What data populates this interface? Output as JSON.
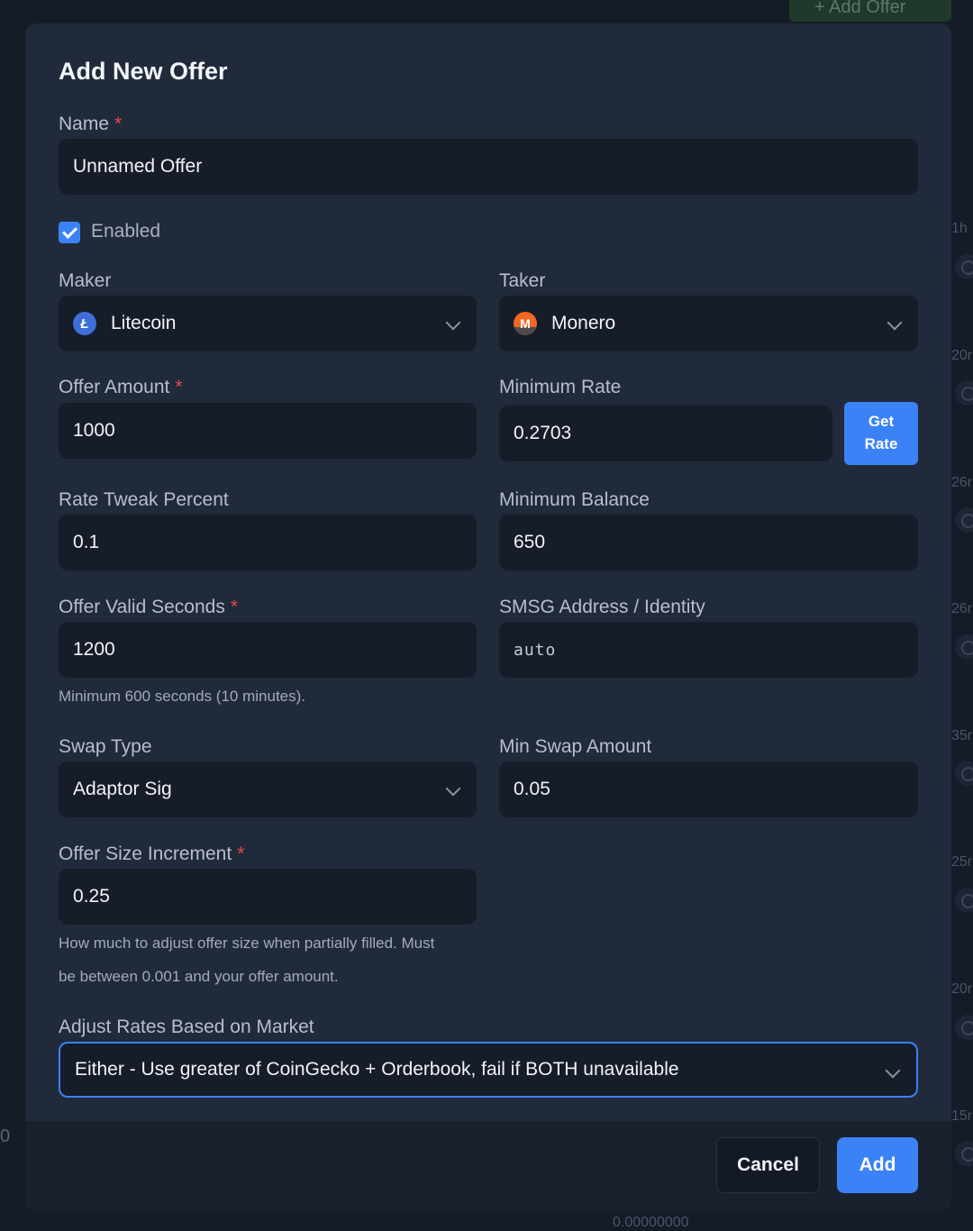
{
  "background": {
    "add_offer_button": "+ Add Offer",
    "left_value": "0",
    "bottom_value": "0.00000000",
    "right_column": [
      "1h",
      "20r",
      "26r",
      "26r",
      "35r",
      "25r",
      "20r",
      "15r"
    ]
  },
  "modal": {
    "title": "Add New Offer",
    "name": {
      "label": "Name",
      "required_mark": "*",
      "value": "Unnamed Offer"
    },
    "enabled": {
      "label": "Enabled",
      "checked": true
    },
    "maker": {
      "label": "Maker",
      "value": "Litecoin",
      "icon": "litecoin-icon"
    },
    "taker": {
      "label": "Taker",
      "value": "Monero",
      "icon": "monero-icon"
    },
    "offer_amount": {
      "label": "Offer Amount",
      "required_mark": "*",
      "value": "1000"
    },
    "minimum_rate": {
      "label": "Minimum Rate",
      "value": "0.2703",
      "get_rate_line1": "Get",
      "get_rate_line2": "Rate"
    },
    "rate_tweak_percent": {
      "label": "Rate Tweak Percent",
      "value": "0.1"
    },
    "minimum_balance": {
      "label": "Minimum Balance",
      "value": "650"
    },
    "offer_valid_seconds": {
      "label": "Offer Valid Seconds",
      "required_mark": "*",
      "value": "1200",
      "hint": "Minimum 600 seconds (10 minutes)."
    },
    "smsg_address": {
      "label": "SMSG Address / Identity",
      "value": "auto"
    },
    "swap_type": {
      "label": "Swap Type",
      "value": "Adaptor Sig"
    },
    "min_swap_amount": {
      "label": "Min Swap Amount",
      "value": "0.05"
    },
    "offer_size_increment": {
      "label": "Offer Size Increment",
      "required_mark": "*",
      "value": "0.25",
      "hint_line1": "How much to adjust offer size when partially filled. Must",
      "hint_line2": "be between 0.001 and your offer amount."
    },
    "adjust_rates": {
      "label": "Adjust Rates Based on Market",
      "value": "Either - Use greater of CoinGecko + Orderbook, fail if BOTH unavailable"
    },
    "footer": {
      "cancel_label": "Cancel",
      "add_label": "Add"
    }
  },
  "colors": {
    "accent": "#3b82f6",
    "required": "#e5484d",
    "litecoin": "#3e6fd8",
    "monero": "#f26822"
  }
}
